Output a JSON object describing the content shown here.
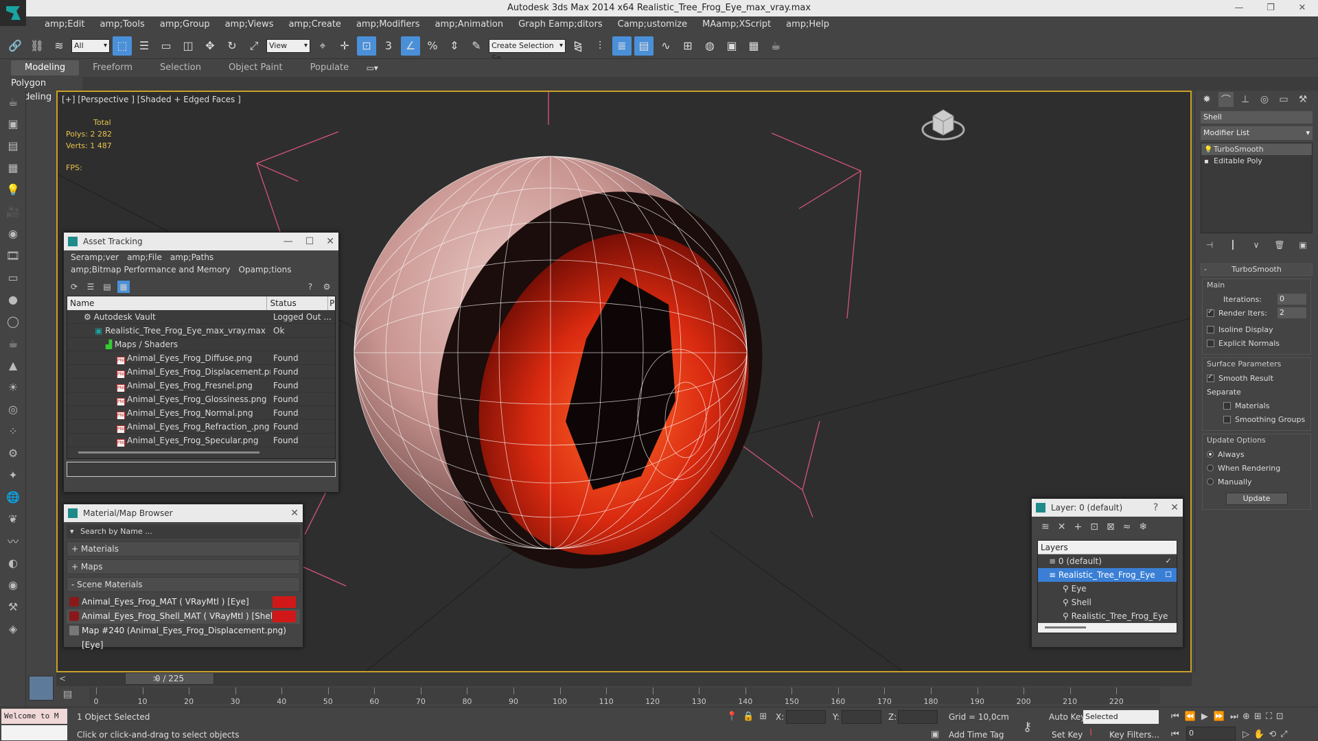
{
  "app": {
    "title": "Autodesk 3ds Max  2014 x64      Realistic_Tree_Frog_Eye_max_vray.max"
  },
  "menu": [
    "amp;Edit",
    "amp;Tools",
    "amp;Group",
    "amp;Views",
    "amp;Create",
    "amp;Modifiers",
    "amp;Animation",
    "Graph Eamp;ditors",
    "Camp;ustomize",
    "MAamp;XScript",
    "amp;Help"
  ],
  "toolbar": {
    "selection_filter": "All",
    "ref_coord": "View",
    "named_selection_placeholder": "Create Selection Se"
  },
  "ribbon": {
    "tabs": [
      "Modeling",
      "Freeform",
      "Selection",
      "Object Paint",
      "Populate"
    ],
    "sub_label": "Polygon Modeling"
  },
  "viewport": {
    "label": "[+] [Perspective ] [Shaded + Edged Faces ]",
    "stats_total": "Total",
    "polys_label": "Polys:",
    "polys_value": "2 282",
    "verts_label": "Verts:",
    "verts_value": "1 487",
    "fps_label": "FPS:"
  },
  "command_panel": {
    "object_name": "Shell",
    "modifier_list": "Modifier List",
    "stack": [
      "TurboSmooth",
      "Editable Poly"
    ],
    "rollout_title": "TurboSmooth",
    "main_group": "Main",
    "iterations_label": "Iterations:",
    "iterations_value": "0",
    "render_iters_label": "Render Iters:",
    "render_iters_value": "2",
    "isoline_label": "Isoline Display",
    "explicit_normals_label": "Explicit Normals",
    "surface_group": "Surface Parameters",
    "smooth_result_label": "Smooth Result",
    "separate_label": "Separate",
    "materials_label": "Materials",
    "smoothing_groups_label": "Smoothing Groups",
    "update_group": "Update Options",
    "always_label": "Always",
    "when_rendering_label": "When Rendering",
    "manually_label": "Manually",
    "update_button": "Update"
  },
  "asset_tracking": {
    "title": "Asset Tracking",
    "menu": [
      "Seramp;ver",
      "amp;File",
      "amp;Paths",
      "amp;Bitmap Performance and Memory",
      "Opamp;tions"
    ],
    "columns": [
      "Name",
      "Status",
      "P"
    ],
    "rows": [
      {
        "name": "Autodesk Vault",
        "status": "Logged Out ...",
        "indent": 1
      },
      {
        "name": "Realistic_Tree_Frog_Eye_max_vray.max",
        "status": "Ok",
        "indent": 2
      },
      {
        "name": "Maps / Shaders",
        "status": "",
        "indent": 3
      },
      {
        "name": "Animal_Eyes_Frog_Diffuse.png",
        "status": "Found",
        "indent": 4
      },
      {
        "name": "Animal_Eyes_Frog_Displacement.png",
        "status": "Found",
        "indent": 4
      },
      {
        "name": "Animal_Eyes_Frog_Fresnel.png",
        "status": "Found",
        "indent": 4
      },
      {
        "name": "Animal_Eyes_Frog_Glossiness.png",
        "status": "Found",
        "indent": 4
      },
      {
        "name": "Animal_Eyes_Frog_Normal.png",
        "status": "Found",
        "indent": 4
      },
      {
        "name": "Animal_Eyes_Frog_Refraction_.png",
        "status": "Found",
        "indent": 4
      },
      {
        "name": "Animal_Eyes_Frog_Specular.png",
        "status": "Found",
        "indent": 4
      }
    ]
  },
  "material_browser": {
    "title": "Material/Map Browser",
    "search_placeholder": "Search by Name ...",
    "sections": [
      "+ Materials",
      "+ Maps",
      "- Scene Materials"
    ],
    "items": [
      "Animal_Eyes_Frog_MAT ( VRayMtl ) [Eye]",
      "Animal_Eyes_Frog_Shell_MAT ( VRayMtl ) [Shell]",
      "Map #240 (Animal_Eyes_Frog_Displacement.png) [Eye]"
    ]
  },
  "layers": {
    "title": "Layer: 0 (default)",
    "help": "?",
    "header": "Layers",
    "rows": [
      {
        "name": "0 (default)",
        "indent": 1
      },
      {
        "name": "Realistic_Tree_Frog_Eye",
        "indent": 1
      },
      {
        "name": "Eye",
        "indent": 2
      },
      {
        "name": "Shell",
        "indent": 2
      },
      {
        "name": "Realistic_Tree_Frog_Eye",
        "indent": 2
      }
    ]
  },
  "timeline": {
    "slider": "0 / 225",
    "ticks": [
      0,
      10,
      20,
      30,
      40,
      50,
      60,
      70,
      80,
      90,
      100,
      110,
      120,
      130,
      140,
      150,
      160,
      170,
      180,
      190,
      200,
      210,
      220
    ]
  },
  "status": {
    "welcome": "Welcome to M",
    "selected": "1 Object Selected",
    "prompt": "Click or click-and-drag to select objects",
    "x_label": "X:",
    "y_label": "Y:",
    "z_label": "Z:",
    "grid": "Grid = 10,0cm",
    "add_time_tag": "Add Time Tag",
    "auto_key": "Auto Key",
    "selected_dd": "Selected",
    "set_key": "Set Key",
    "key_filters": "Key Filters...",
    "frame": "0"
  },
  "colors": {
    "accent": "#4a90d9",
    "viewport_border": "#c9a227",
    "stats": "#e8c34a",
    "material_red": "#d01818"
  }
}
